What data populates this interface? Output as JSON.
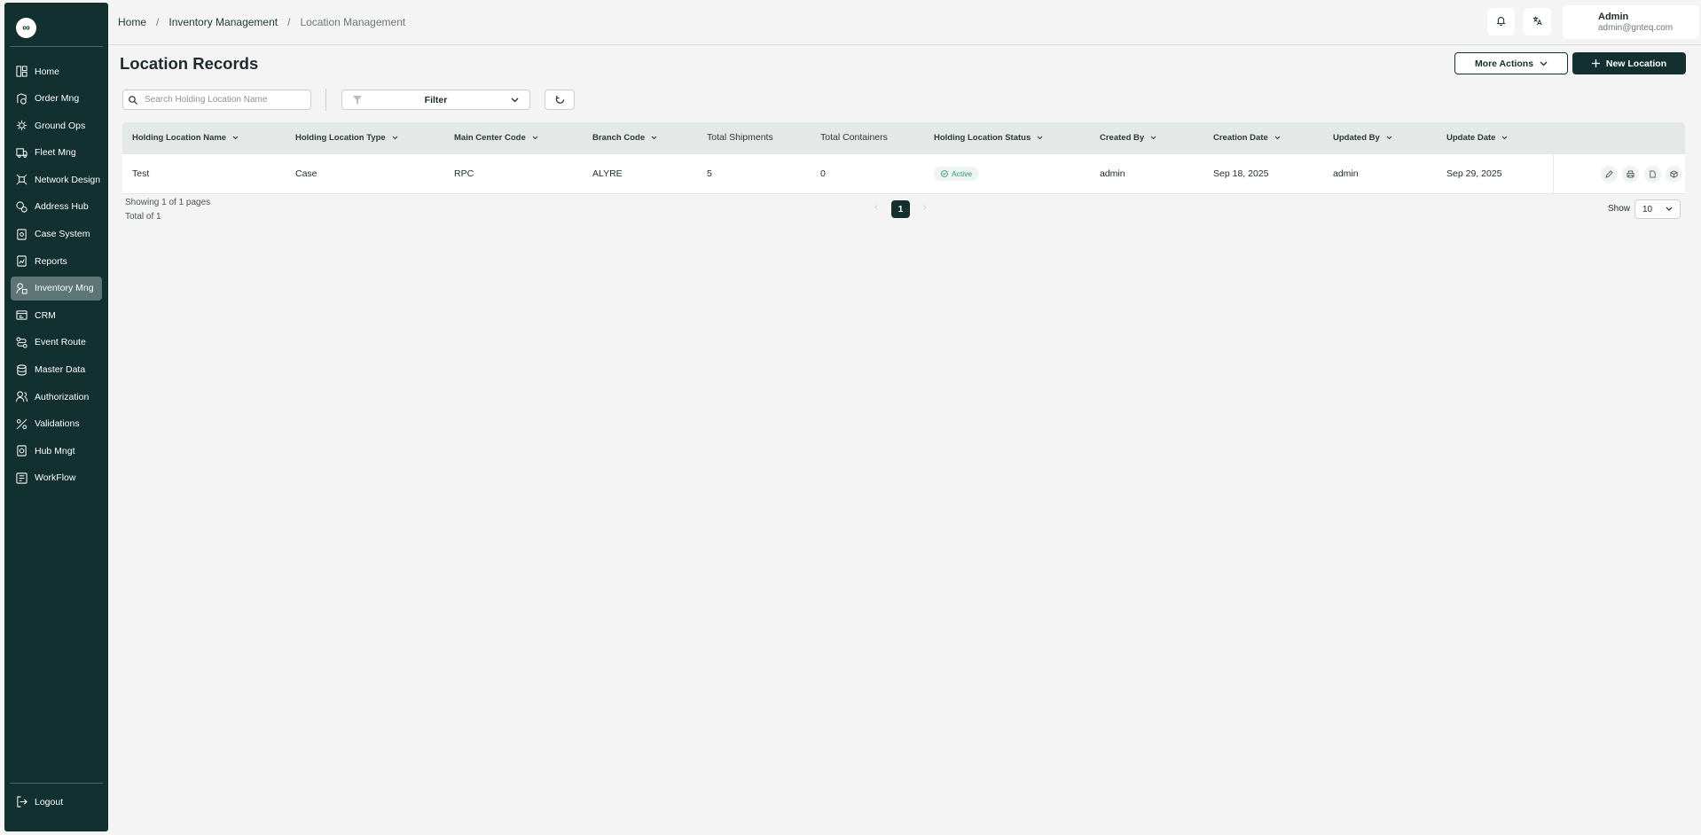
{
  "app": {
    "logo_text": "∞"
  },
  "sidebar": {
    "items": [
      {
        "label": "Home",
        "icon": "dashboard-icon"
      },
      {
        "label": "Order Mng",
        "icon": "order-icon"
      },
      {
        "label": "Ground Ops",
        "icon": "ground-ops-icon"
      },
      {
        "label": "Fleet Mng",
        "icon": "truck-icon"
      },
      {
        "label": "Network Design",
        "icon": "network-icon"
      },
      {
        "label": "Address Hub",
        "icon": "address-icon"
      },
      {
        "label": "Case System",
        "icon": "case-icon"
      },
      {
        "label": "Reports",
        "icon": "report-icon"
      },
      {
        "label": "Inventory Mng",
        "icon": "inventory-icon",
        "active": true
      },
      {
        "label": "CRM",
        "icon": "crm-icon"
      },
      {
        "label": "Event Route",
        "icon": "route-icon"
      },
      {
        "label": "Master Data",
        "icon": "database-icon"
      },
      {
        "label": "Authorization",
        "icon": "users-icon"
      },
      {
        "label": "Validations",
        "icon": "validation-icon"
      },
      {
        "label": "Hub Mngt",
        "icon": "hub-icon"
      },
      {
        "label": "WorkFlow",
        "icon": "workflow-icon"
      }
    ],
    "logout_label": "Logout"
  },
  "header": {
    "breadcrumb": [
      "Home",
      "Inventory Management",
      "Location Management"
    ],
    "user": {
      "name": "Admin",
      "email": "admin@gnteq.com"
    }
  },
  "main": {
    "title": "Location Records",
    "more_actions_label": "More Actions",
    "new_button_label": "New Location",
    "search_placeholder": "Search Holding Location Name",
    "filter_label": "Filter"
  },
  "table": {
    "columns": [
      "Holding Location Name",
      "Holding Location Type",
      "Main Center Code",
      "Branch Code",
      "Total Shipments",
      "Total Containers",
      "Holding Location Status",
      "Created By",
      "Creation Date",
      "Updated By",
      "Update Date"
    ],
    "rows": [
      {
        "name": "Test",
        "type": "Case",
        "main_center_code": "RPC",
        "branch_code": "ALYRE",
        "total_shipments": "5",
        "total_containers": "0",
        "status": "Active",
        "created_by": "admin",
        "creation_date": "Sep 18, 2025",
        "updated_by": "admin",
        "update_date": "Sep 29, 2025"
      }
    ]
  },
  "pagination": {
    "showing_text": "Showing 1 of 1 pages",
    "total_text": "Total of 1",
    "current_page": "1",
    "show_label": "Show",
    "page_size": "10"
  },
  "colors": {
    "sidebar_bg": "#12302f",
    "accent": "#12302f",
    "status_active": "#2f9e6e",
    "page_bg": "#f3f4f3"
  }
}
